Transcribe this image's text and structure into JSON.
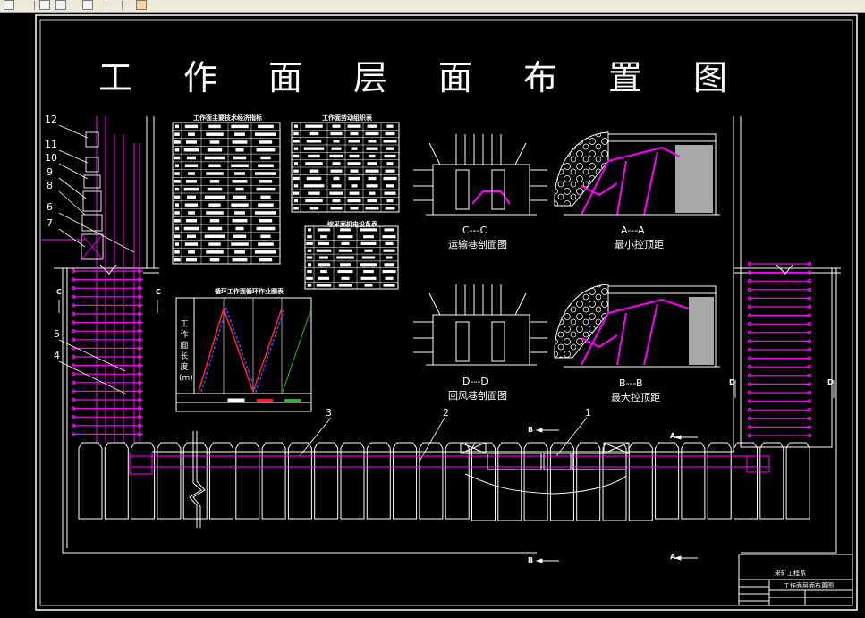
{
  "drawing": {
    "title": "工作面层面布置图",
    "section_cc": "C---C",
    "section_cc_caption": "运输巷剖面图",
    "section_dd": "D---D",
    "section_dd_caption": "回风巷剖面图",
    "section_aa": "A---A",
    "section_aa_caption": "最小控顶距",
    "section_bb": "B---B",
    "section_bb_caption": "最大控顶距",
    "table1_title": "工作面主要技术经济指标",
    "table2_title": "工作面劳动组织表",
    "table3_title": "综采面机电设备表",
    "chart_title": "循环工作面循环作业图表",
    "chart_ylabel": [
      "工",
      "作",
      "面",
      "长",
      "度",
      "(m)"
    ],
    "callouts": [
      "12",
      "11",
      "10",
      "9",
      "8",
      "6",
      "7",
      "5",
      "4",
      "3",
      "2",
      "1"
    ],
    "marker_c": "C",
    "marker_d": "D",
    "marker_a": "A",
    "marker_b": "B",
    "titleblock_org": "采矿工程系",
    "titleblock_name": "工作面层面布置图"
  },
  "colors": {
    "background": "#000000",
    "lines": "#ffffff",
    "magenta": "#ff00ff",
    "red": "#ff2020",
    "blue": "#3050ff",
    "green": "#20c020",
    "gray_fill": "#a8a8a8"
  }
}
